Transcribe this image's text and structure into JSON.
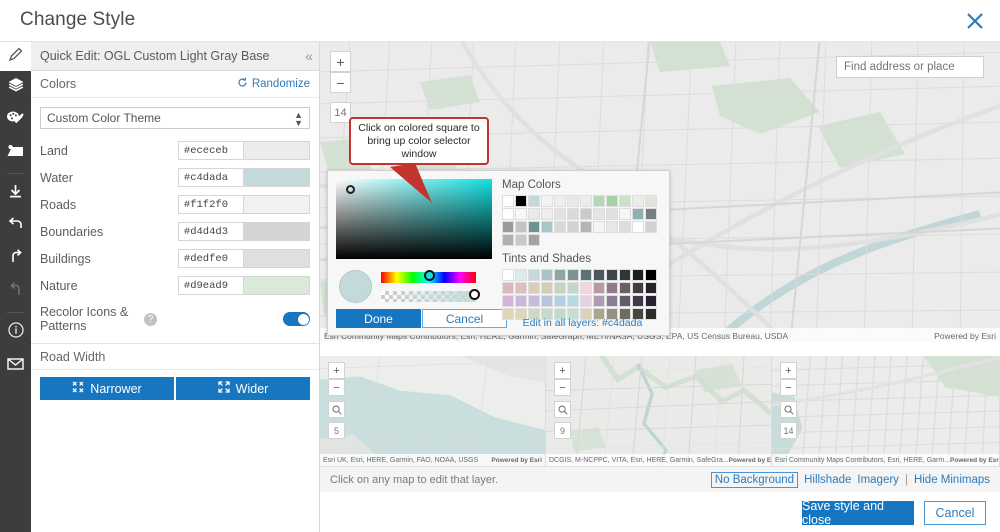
{
  "header": {
    "title": "Change Style",
    "close_icon": "close-icon"
  },
  "rail": {
    "items": [
      {
        "name": "pencil-icon",
        "label": "Edit"
      },
      {
        "name": "layers-icon",
        "label": "Layers"
      },
      {
        "name": "palette-icon",
        "label": "Colors"
      },
      {
        "name": "image-icon",
        "label": "Images"
      },
      {
        "name": "download-icon",
        "label": "Download"
      },
      {
        "name": "undo-icon",
        "label": "Undo"
      },
      {
        "name": "redo-icon",
        "label": "Redo"
      },
      {
        "name": "redo-disabled-icon",
        "label": "Redo Disabled"
      },
      {
        "name": "info-icon",
        "label": "Info"
      },
      {
        "name": "mail-icon",
        "label": "Contact"
      }
    ]
  },
  "panel": {
    "quick_edit_label": "Quick Edit: OGL Custom Light Gray Base",
    "collapse_icon": "chevron-double-left-icon",
    "colors_section_label": "Colors",
    "randomize_label": "Randomize",
    "randomize_icon": "refresh-icon",
    "theme_select_value": "Custom Color Theme",
    "color_rows": [
      {
        "label": "Land",
        "hex": "#ececeb",
        "swatch": "#ececeb"
      },
      {
        "label": "Water",
        "hex": "#c4dada",
        "swatch": "#c4dada"
      },
      {
        "label": "Roads",
        "hex": "#f1f2f0",
        "swatch": "#f1f2f0"
      },
      {
        "label": "Boundaries",
        "hex": "#d4d4d3",
        "swatch": "#d4d4d3"
      },
      {
        "label": "Buildings",
        "hex": "#dedfe0",
        "swatch": "#dedfe0"
      },
      {
        "label": "Nature",
        "hex": "#d9ead9",
        "swatch": "#d9ead9"
      }
    ],
    "recolor_label": "Recolor Icons & Patterns",
    "recolor_help_icon": "help-icon",
    "recolor_enabled": true,
    "road_width_label": "Road Width",
    "narrower_label": "Narrower",
    "narrower_icon": "contract-icon",
    "wider_label": "Wider",
    "wider_icon": "expand-icon"
  },
  "map": {
    "zoom_in_label": "+",
    "zoom_out_label": "−",
    "zoom_level": "14",
    "attribution": "Esri Community Maps Contributors, Esri, HERE, Garmin, SafeGraph, METI/NASA, USGS, EPA, US Census Bureau, USDA",
    "powered_by": "Powered by Esri",
    "search_placeholder": "Find address or place",
    "search_value": "",
    "search_icon": "search-icon"
  },
  "callout": {
    "text": "Click on colored square to bring up color selector window",
    "border_color": "#c4342f"
  },
  "picker": {
    "current_color": "#c4dada",
    "done_label": "Done",
    "cancel_label": "Cancel",
    "map_colors_label": "Map Colors",
    "tints_label": "Tints and Shades",
    "edit_all_label": "Edit in all layers: #c4dada",
    "map_colors": [
      "#ffffff",
      "#000000",
      "#c4dada",
      "#f3f3f1",
      "#eeefed",
      "#e9eae8",
      "#eceeea",
      "#b4d8b4",
      "#a6d2a6",
      "#c9e3c9",
      "#eaeee8",
      "#e2e4e0",
      "#ffffff",
      "#f7f7f5",
      "#eaeae8",
      "#ededeb",
      "#e2e3e1",
      "#d9dad8",
      "#c8cbc8",
      "#e4e5e3",
      "#e0e2e0",
      "#f6f7f5",
      "#8fb0b0",
      "#767e7e",
      "#9a9a9a",
      "#c3c3c3",
      "#6f9292",
      "#a8c6c6",
      "#d8d9d7",
      "#d2d3d1",
      "#b4b5b3",
      "#f4f5f3",
      "#e7e8e6",
      "#dddedc",
      "#ffffff",
      "#d2d3d1",
      "#b0b0b0",
      "#c9c9c9",
      "#a3a3a3"
    ],
    "tints_and_shades": [
      "#ffffff",
      "#dbeaea",
      "#c4dada",
      "#a9c2c2",
      "#8ca5a5",
      "#7a9494",
      "#5d7373",
      "#49595b",
      "#3b494b",
      "#2d3639",
      "#1b2122",
      "#000000",
      "#d9b9b9",
      "#dcc0b8",
      "#d8cdb6",
      "#cdd0b5",
      "#c5d3c0",
      "#bfd6c8",
      "#f0d5dc",
      "#b99aa3",
      "#917b84",
      "#6d5f64",
      "#453c41",
      "#29242a",
      "#d4b3d4",
      "#cbb6dd",
      "#c2bce1",
      "#b6c5e2",
      "#b0cfe4",
      "#b3dbe4",
      "#e8d1e6",
      "#b09ab4",
      "#8b7c95",
      "#645a6b",
      "#3f3948",
      "#272230",
      "#e0d6b6",
      "#dcd6bb",
      "#cfd8c2",
      "#c6dac8",
      "#c2dbce",
      "#c6ddd4",
      "#ddd2b9",
      "#aaa492",
      "#939183",
      "#6e6d62",
      "#474740",
      "#2c2c28"
    ]
  },
  "minimaps": [
    {
      "zoom": "5",
      "attribution": "Esri UK, Esri, HERE, Garmin, FAO, NOAA, USGS",
      "powered_by": "Powered by Esri",
      "zoom_in": "+",
      "zoom_out": "−",
      "search_icon": "search-icon"
    },
    {
      "zoom": "9",
      "attribution": "DCGIS, M-NCPPC, VITA, Esri, HERE, Garmin, SafeGra...",
      "powered_by": "Powered by Esri",
      "zoom_in": "+",
      "zoom_out": "−",
      "search_icon": "search-icon"
    },
    {
      "zoom": "14",
      "attribution": "Esri Community Maps Contributors, Esri, HERE, Garm...",
      "powered_by": "Powered by Esri",
      "zoom_in": "+",
      "zoom_out": "−",
      "search_icon": "search-icon"
    }
  ],
  "bottom": {
    "hint": "Click on any map to edit that layer.",
    "no_background_label": "No Background",
    "hillshade_label": "Hillshade",
    "imagery_label": "Imagery",
    "separator": "|",
    "hide_minimaps_label": "Hide Minimaps",
    "save_label": "Save style and close",
    "cancel_label": "Cancel"
  },
  "theme": {
    "accent": "#1676c0",
    "link": "#2e7cbd",
    "rail_bg": "#3d3d3d"
  }
}
